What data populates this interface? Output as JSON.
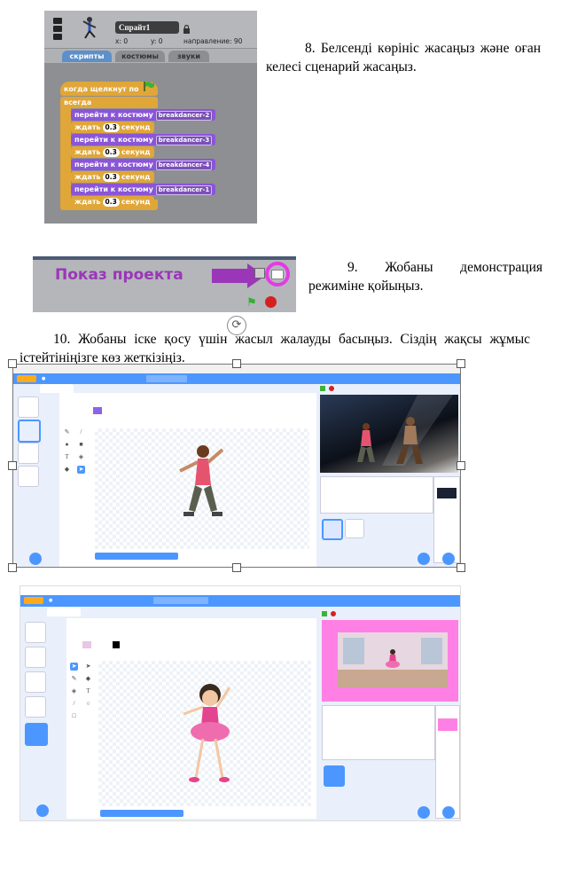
{
  "step8": {
    "text": "8. Белсенді көрініс жасаңыз және оған келесі сценарий жасаңыз."
  },
  "step9": {
    "text": "9. Жобаны демонстрация режиміне қойыңыз."
  },
  "step10": {
    "text": "10. Жобаны іске қосу үшін жасыл жалауды басыңыз. Сіздің жақсы жұмыс істейтініңізге көз жеткізіңіз."
  },
  "scratch14": {
    "sprite_name": "Спрайт1",
    "x_label": "x: 0",
    "y_label": "y: 0",
    "direction_label": "направление: 90",
    "tabs": [
      "скрипты",
      "костюмы",
      "звуки"
    ],
    "blocks": {
      "hat": "когда щелкнут по",
      "forever": "всегда",
      "switch_label": "перейти к костюму",
      "wait_label": "ждать",
      "seconds_label": "секунд",
      "wait_value": "0.3",
      "costumes": [
        "breakdancer-2",
        "breakdancer-3",
        "breakdancer-4",
        "breakdancer-1"
      ]
    }
  },
  "presentation": {
    "label": "Показ проекта"
  },
  "icons": [
    "green-flag-icon",
    "stop-icon",
    "presentation-mode-icon",
    "rotate-handle-icon"
  ]
}
